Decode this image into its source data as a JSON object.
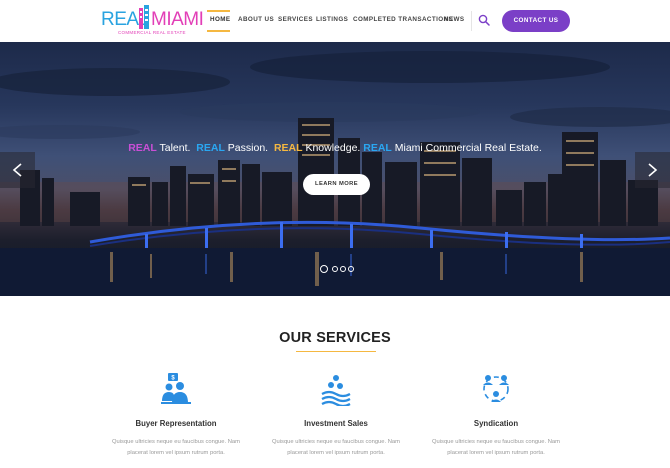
{
  "brand": {
    "logo_word_1": "REAL",
    "logo_word_2": "MIAMI",
    "logo_tagline": "COMMERCIAL REAL ESTATE",
    "color_real": "#29a3e0",
    "color_miami": "#e23fb7"
  },
  "nav": {
    "items": [
      {
        "label": "HOME",
        "active": true
      },
      {
        "label": "ABOUT US"
      },
      {
        "label": "SERVICES"
      },
      {
        "label": "LISTINGS"
      },
      {
        "label": "COMPLETED TRANSACTIONS"
      },
      {
        "label": "NEWS"
      }
    ],
    "search_icon": "search-icon",
    "contact_label": "CONTACT US",
    "accent": "#7b3fc7",
    "underline_color": "#f5b841"
  },
  "hero": {
    "tagline": [
      {
        "word": "REAL",
        "rest": " Talent.",
        "color": "#c94fd6"
      },
      {
        "word": "REAL",
        "rest": " Passion.",
        "color": "#2aa7f2"
      },
      {
        "word": "REAL",
        "rest": " Knowledge.",
        "color": "#f5b841"
      },
      {
        "word": "REAL",
        "rest": " Miami Commercial Real Estate.",
        "color": "#2aa7f2"
      }
    ],
    "button_label": "LEARN MORE",
    "prev_icon": "chevron-left-icon",
    "next_icon": "chevron-right-icon",
    "slide_count": 4,
    "active_slide": 1
  },
  "services": {
    "title": "OUR SERVICES",
    "items": [
      {
        "icon": "buyer-representation-icon",
        "title": "Buyer Representation",
        "text": "Quisque ultricies neque eu faucibus congue. Nam placerat lorem vel ipsum rutrum porta."
      },
      {
        "icon": "investment-sales-icon",
        "title": "Investment Sales",
        "text": "Quisque ultricies neque eu faucibus congue. Nam placerat lorem vel ipsum rutrum porta."
      },
      {
        "icon": "syndication-icon",
        "title": "Syndication",
        "text": "Quisque ultricies neque eu faucibus congue. Nam placerat lorem vel ipsum rutrum porta."
      }
    ],
    "icon_color": "#2b8de0"
  }
}
